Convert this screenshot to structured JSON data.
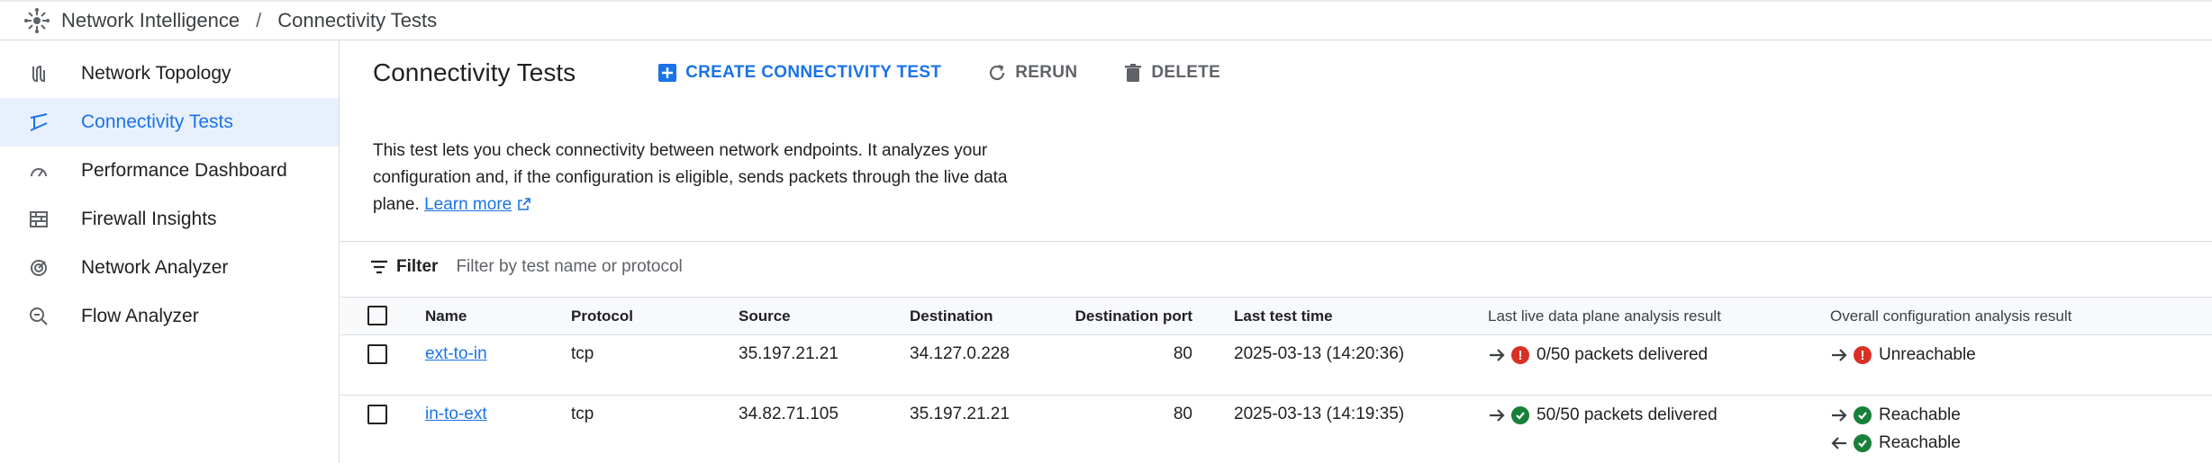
{
  "breadcrumb": {
    "app": "Network Intelligence",
    "separator": "/",
    "page": "Connectivity Tests"
  },
  "sidebar": {
    "items": [
      {
        "label": "Network Topology",
        "icon": "topology-icon"
      },
      {
        "label": "Connectivity Tests",
        "icon": "connectivity-icon",
        "active": true
      },
      {
        "label": "Performance Dashboard",
        "icon": "gauge-icon"
      },
      {
        "label": "Firewall Insights",
        "icon": "firewall-icon"
      },
      {
        "label": "Network Analyzer",
        "icon": "analyzer-icon"
      },
      {
        "label": "Flow Analyzer",
        "icon": "flow-search-icon"
      }
    ]
  },
  "header": {
    "title": "Connectivity Tests",
    "create_label": "CREATE CONNECTIVITY TEST",
    "rerun_label": "RERUN",
    "delete_label": "DELETE"
  },
  "description": {
    "line1": "This test lets you check connectivity between network endpoints. It analyzes your",
    "line2": "configuration and, if the configuration is eligible, sends packets through the live data",
    "line3": "plane.",
    "learn_more": "Learn more"
  },
  "filter": {
    "label": "Filter",
    "placeholder": "Filter by test name or protocol"
  },
  "table": {
    "headers": {
      "name": "Name",
      "protocol": "Protocol",
      "source": "Source",
      "destination": "Destination",
      "destination_port": "Destination port",
      "last_test_time": "Last test time",
      "live_result": "Last live data plane analysis result",
      "config_result": "Overall configuration analysis result"
    },
    "rows": [
      {
        "name": "ext-to-in",
        "protocol": "tcp",
        "source": "35.197.21.21",
        "destination": "34.127.0.228",
        "port": "80",
        "time": "2025-03-13 (14:20:36)",
        "live": "0/50 packets delivered",
        "live_status": "error",
        "config": [
          "Unreachable"
        ],
        "config_status": [
          "error"
        ]
      },
      {
        "name": "in-to-ext",
        "protocol": "tcp",
        "source": "34.82.71.105",
        "destination": "35.197.21.21",
        "port": "80",
        "time": "2025-03-13 (14:19:35)",
        "live": "50/50 packets delivered",
        "live_status": "ok",
        "config": [
          "Reachable",
          "Reachable"
        ],
        "config_status": [
          "ok",
          "ok"
        ]
      }
    ]
  },
  "colors": {
    "accent": "#1a73e8",
    "error": "#d93025",
    "success": "#188038",
    "active_bg": "#e8f0fe"
  }
}
